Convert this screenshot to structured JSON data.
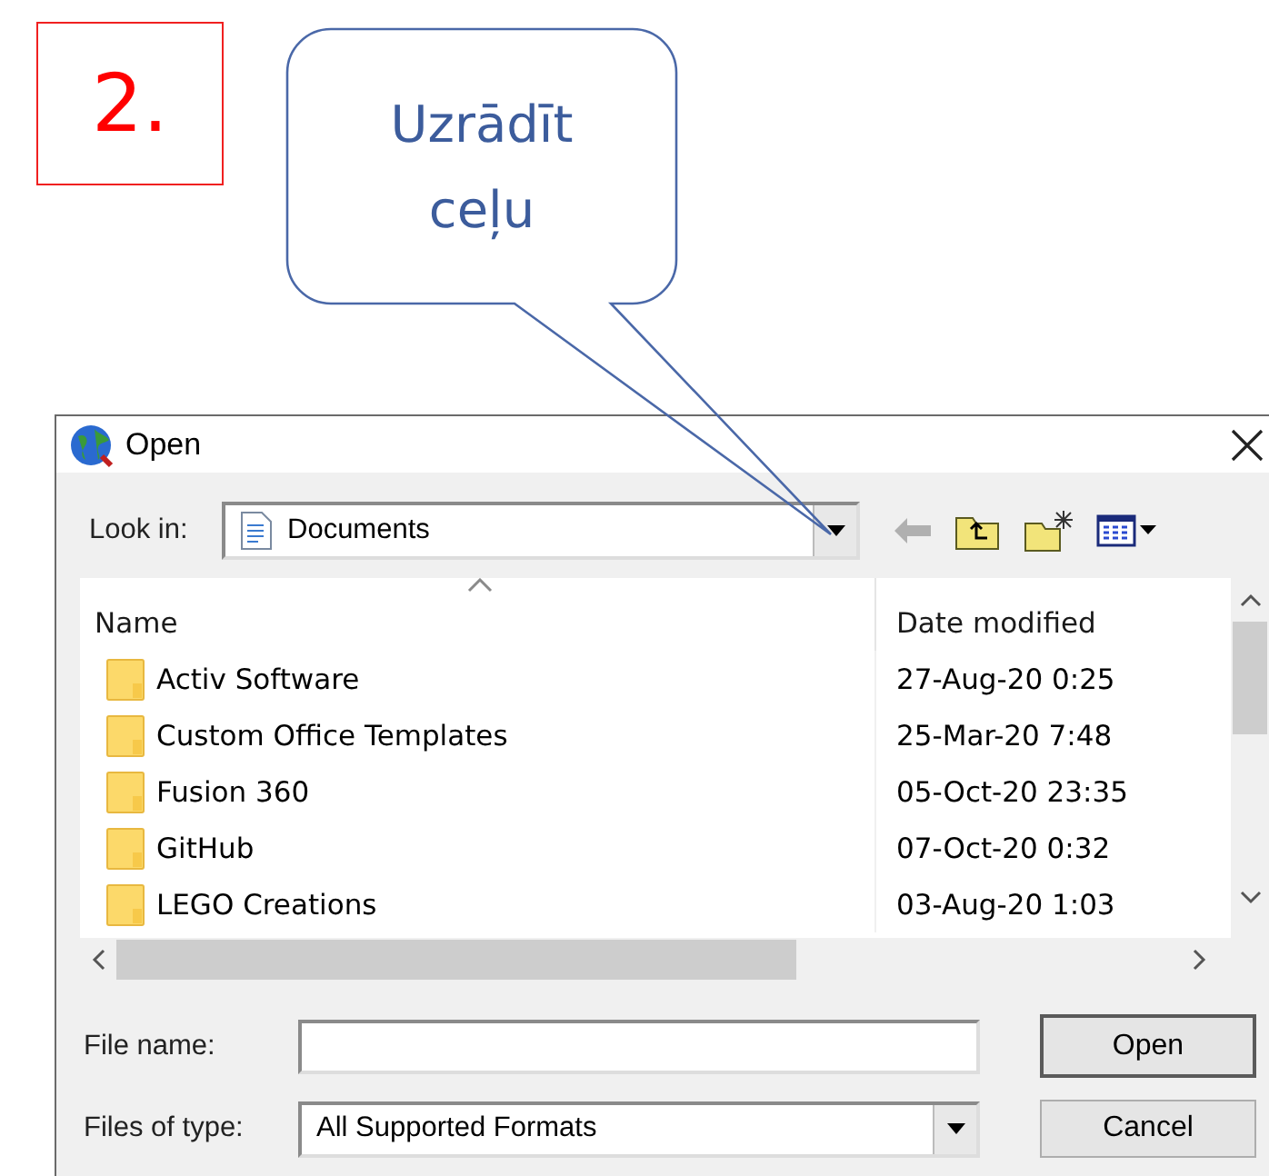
{
  "label_box": {
    "text": "2."
  },
  "callout": {
    "text": "Uzrādīt ceļu"
  },
  "dialog": {
    "title": "Open",
    "look_in": {
      "label": "Look in:",
      "value": "Documents"
    },
    "columns": [
      {
        "label": "Name",
        "sorted": true
      },
      {
        "label": "Date modified",
        "sorted": false
      }
    ],
    "rows": [
      {
        "name": "Activ Software",
        "date": "27-Aug-20 0:25"
      },
      {
        "name": "Custom Office Templates",
        "date": "25-Mar-20 7:48"
      },
      {
        "name": "Fusion 360",
        "date": "05-Oct-20 23:35"
      },
      {
        "name": "GitHub",
        "date": "07-Oct-20 0:32"
      },
      {
        "name": "LEGO Creations",
        "date": "03-Aug-20 1:03"
      }
    ],
    "file_name": {
      "label": "File name:"
    },
    "file_type": {
      "label": "Files of type:",
      "value": "All Supported Formats"
    },
    "buttons": [
      {
        "label": "Open",
        "default": true
      },
      {
        "label": "Cancel",
        "default": false
      }
    ]
  }
}
